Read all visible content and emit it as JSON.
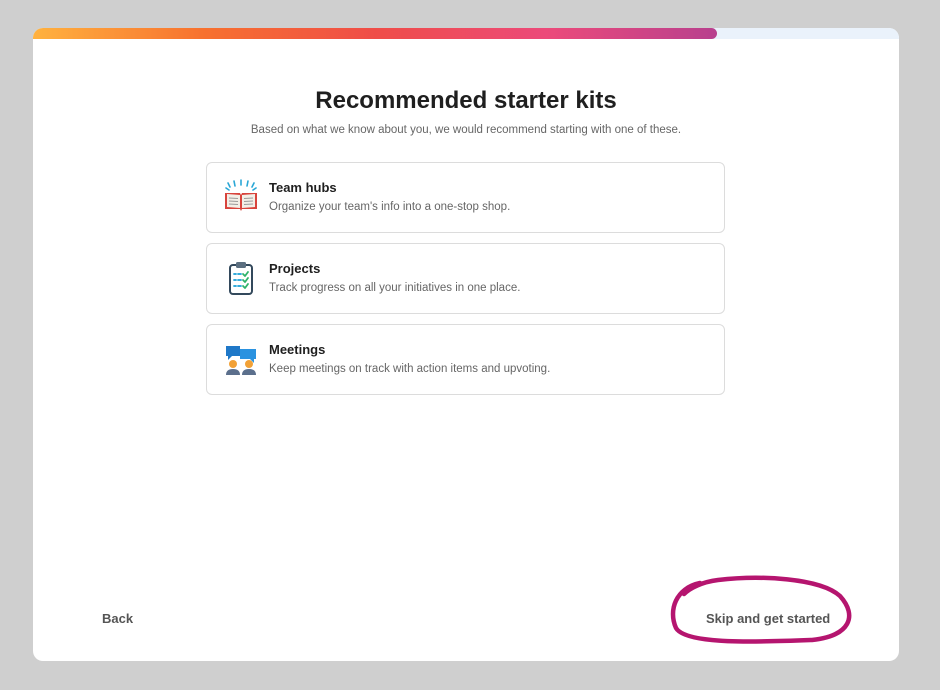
{
  "progress": {
    "fraction": 0.79
  },
  "header": {
    "title": "Recommended starter kits",
    "subtitle": "Based on what we know about you, we would recommend starting with one of these."
  },
  "kits": [
    {
      "name": "Team hubs",
      "description": "Organize your team's info into a one-stop shop.",
      "icon": "open-book-icon"
    },
    {
      "name": "Projects",
      "description": "Track progress on all your initiatives in one place.",
      "icon": "clipboard-checklist-icon"
    },
    {
      "name": "Meetings",
      "description": "Keep meetings on track with action items and upvoting.",
      "icon": "meeting-people-icon"
    }
  ],
  "footer": {
    "back_label": "Back",
    "skip_label": "Skip and get started"
  },
  "colors": {
    "annotation": "#b5156f",
    "accent_gradient": [
      "#ffb23f",
      "#f7712f",
      "#ef4d48",
      "#ec4a7a",
      "#b8408e"
    ]
  }
}
